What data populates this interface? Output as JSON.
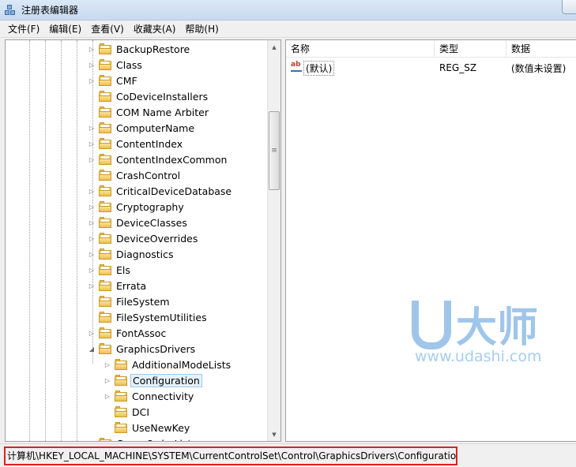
{
  "window": {
    "title": "注册表编辑器"
  },
  "menu": [
    "文件(F)",
    "编辑(E)",
    "查看(V)",
    "收藏夹(A)",
    "帮助(H)"
  ],
  "tree": {
    "items": [
      {
        "label": "BackupRestore",
        "expander": "collapsed",
        "level": 0
      },
      {
        "label": "Class",
        "expander": "collapsed",
        "level": 0
      },
      {
        "label": "CMF",
        "expander": "collapsed",
        "level": 0
      },
      {
        "label": "CoDeviceInstallers",
        "expander": "none",
        "level": 0
      },
      {
        "label": "COM Name Arbiter",
        "expander": "none",
        "level": 0
      },
      {
        "label": "ComputerName",
        "expander": "collapsed",
        "level": 0
      },
      {
        "label": "ContentIndex",
        "expander": "collapsed",
        "level": 0
      },
      {
        "label": "ContentIndexCommon",
        "expander": "collapsed",
        "level": 0
      },
      {
        "label": "CrashControl",
        "expander": "none",
        "level": 0
      },
      {
        "label": "CriticalDeviceDatabase",
        "expander": "collapsed",
        "level": 0
      },
      {
        "label": "Cryptography",
        "expander": "collapsed",
        "level": 0
      },
      {
        "label": "DeviceClasses",
        "expander": "collapsed",
        "level": 0
      },
      {
        "label": "DeviceOverrides",
        "expander": "collapsed",
        "level": 0
      },
      {
        "label": "Diagnostics",
        "expander": "collapsed",
        "level": 0
      },
      {
        "label": "Els",
        "expander": "collapsed",
        "level": 0
      },
      {
        "label": "Errata",
        "expander": "collapsed",
        "level": 0
      },
      {
        "label": "FileSystem",
        "expander": "none",
        "level": 0
      },
      {
        "label": "FileSystemUtilities",
        "expander": "none",
        "level": 0
      },
      {
        "label": "FontAssoc",
        "expander": "collapsed",
        "level": 0
      },
      {
        "label": "GraphicsDrivers",
        "expander": "expanded",
        "level": 0
      },
      {
        "label": "AdditionalModeLists",
        "expander": "collapsed",
        "level": 1
      },
      {
        "label": "Configuration",
        "expander": "collapsed",
        "level": 1,
        "selected": true
      },
      {
        "label": "Connectivity",
        "expander": "collapsed",
        "level": 1
      },
      {
        "label": "DCI",
        "expander": "none",
        "level": 1
      },
      {
        "label": "UseNewKey",
        "expander": "none",
        "level": 1
      },
      {
        "label": "GroupOrderList",
        "expander": "none",
        "level": 0
      }
    ]
  },
  "list": {
    "columns": [
      "名称",
      "类型",
      "数据"
    ],
    "rows": [
      {
        "name": "(默认)",
        "type": "REG_SZ",
        "data": "(数值未设置)",
        "icon": "string-value-icon"
      }
    ]
  },
  "watermark": {
    "brand": "大师",
    "url": "www.udashi.com"
  },
  "status": {
    "path": "计算机\\HKEY_LOCAL_MACHINE\\SYSTEM\\CurrentControlSet\\Control\\GraphicsDrivers\\Configuration"
  },
  "colors": {
    "selection_bg": "#e5f1fb",
    "highlight_box": "#e02020",
    "watermark": "#9fc6ea"
  }
}
